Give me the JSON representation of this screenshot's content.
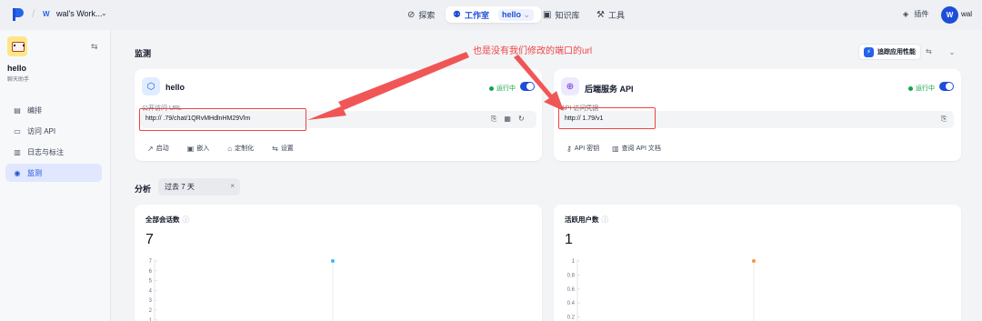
{
  "topbar": {
    "workspace_badge": "W",
    "workspace_name": "wal's Work...",
    "nav": [
      {
        "label": "探索"
      },
      {
        "label": "工作室",
        "app": "hello"
      },
      {
        "label": "知识库"
      },
      {
        "label": "工具"
      }
    ],
    "plugin_label": "插件",
    "avatar_letter": "W",
    "user_name": "wal"
  },
  "sidebar": {
    "app_name": "hello",
    "app_subtitle": "聊天助手",
    "items": [
      {
        "label": "编排",
        "icon": "layout-icon"
      },
      {
        "label": "访问 API",
        "icon": "terminal-icon"
      },
      {
        "label": "日志与标注",
        "icon": "file-text-icon"
      },
      {
        "label": "监测",
        "icon": "monitor-icon",
        "active": true
      }
    ]
  },
  "monitor": {
    "title": "监测",
    "trace_label": "追踪应用性能",
    "annotation": "也是没有我们修改的端口的url"
  },
  "webapp_card": {
    "title": "hello",
    "status": "运行中",
    "url_label": "公开访问 URL",
    "url": "http://              .79/chat/1QRvMHdlnHM29Vlm",
    "actions": [
      "启动",
      "嵌入",
      "定制化",
      "设置"
    ]
  },
  "api_card": {
    "title": "后端服务 API",
    "status": "运行中",
    "url_label": "API 访问凭据",
    "url": "http://          1.79/v1",
    "actions": [
      "API 密钥",
      "查阅 API 文档"
    ]
  },
  "analysis": {
    "title": "分析",
    "period": "过去 7 天"
  },
  "stats": [
    {
      "title": "全部会话数",
      "value": "7"
    },
    {
      "title": "活跃用户数",
      "value": "1"
    }
  ],
  "colors": {
    "accent": "#1d4ed8",
    "running": "#16a34a",
    "annotation": "#ef4444"
  },
  "chart_data": [
    {
      "type": "line",
      "yticks": [
        "7",
        "6",
        "5",
        "4",
        "3",
        "2",
        "1"
      ],
      "ylim": [
        0,
        7
      ],
      "series": [
        {
          "values": [
            7
          ]
        }
      ],
      "marker_color": "#38bdf8"
    },
    {
      "type": "line",
      "yticks": [
        "1",
        "0.8",
        "0.6",
        "0.4",
        "0.2"
      ],
      "ylim": [
        0,
        1
      ],
      "series": [
        {
          "values": [
            1
          ]
        }
      ],
      "marker_color": "#fb923c"
    }
  ]
}
